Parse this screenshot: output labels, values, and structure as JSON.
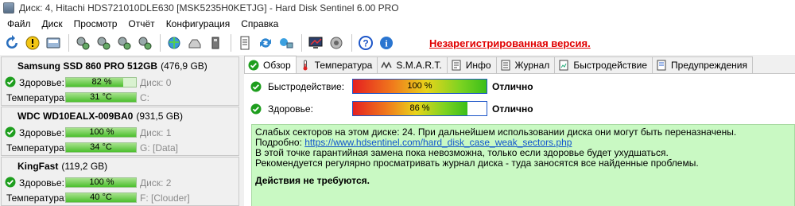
{
  "window": {
    "title": "Диск: 4, Hitachi HDS721010DLE630 [MSK5235H0KETJG]  -  Hard Disk Sentinel 6.00 PRO"
  },
  "menu": [
    "Файл",
    "Диск",
    "Просмотр",
    "Отчёт",
    "Конфигурация",
    "Справка"
  ],
  "toolbar": {
    "buttons": [
      "refresh-icon",
      "alert-icon",
      "disk-check-icon",
      "sep",
      "disk-tools-1-icon",
      "disk-tools-2-icon",
      "disk-tools-3-icon",
      "disk-tools-4-icon",
      "sep",
      "network-icon",
      "drive-icon",
      "usb-drive-icon",
      "sep",
      "report-icon",
      "sync-icon",
      "share-icon",
      "sep",
      "monitor-icon",
      "speaker-icon",
      "sep",
      "help-icon",
      "info-icon"
    ],
    "unregistered": "Незарегистрированная версия."
  },
  "disks": [
    {
      "name": "Samsung SSD 860 PRO 512GB",
      "size": "(476,9 GB)",
      "health_label": "Здоровье:",
      "health": "82 %",
      "health_fraction": 0.82,
      "disk_index": "Диск: 0",
      "temp_label": "Температура:",
      "temp": "31 °C",
      "volume": "C:"
    },
    {
      "name": "WDC WD10EALX-009BA0",
      "size": "(931,5 GB)",
      "health_label": "Здоровье:",
      "health": "100 %",
      "health_fraction": 1.0,
      "disk_index": "Диск: 1",
      "temp_label": "Температура:",
      "temp": "34 °C",
      "volume": "G: [Data]"
    },
    {
      "name": "KingFast",
      "size": "(119,2 GB)",
      "health_label": "Здоровье:",
      "health": "100 %",
      "health_fraction": 1.0,
      "disk_index": "Диск: 2",
      "temp_label": "Температура:",
      "temp": "40 °C",
      "volume": "F: [Clouder]"
    }
  ],
  "tabs": [
    {
      "label": "Обзор",
      "icon": "check-icon",
      "active": true
    },
    {
      "label": "Температура",
      "icon": "thermometer-icon",
      "active": false
    },
    {
      "label": "S.M.A.R.T.",
      "icon": "smart-icon",
      "active": false
    },
    {
      "label": "Инфо",
      "icon": "info-icon",
      "active": false
    },
    {
      "label": "Журнал",
      "icon": "log-icon",
      "active": false
    },
    {
      "label": "Быстродействие",
      "icon": "performance-icon",
      "active": false
    },
    {
      "label": "Предупреждения",
      "icon": "warnings-icon",
      "active": false
    }
  ],
  "overview": {
    "performance": {
      "label": "Быстродействие:",
      "value": "100 %",
      "fraction": 1.0,
      "rating": "Отлично"
    },
    "health": {
      "label": "Здоровье:",
      "value": "86 %",
      "fraction": 0.86,
      "rating": "Отлично"
    },
    "info": {
      "line1": "Слабых секторов на этом диске: 24. При дальнейшем использовании диска они могут быть переназначены.",
      "line2_prefix": "Подробно: ",
      "line2_link": "https://www.hdsentinel.com/hard_disk_case_weak_sectors.php",
      "line3": "В этой точке гарантийная замена пока невозможна, только если здоровье будет ухудшаться.",
      "line4": "Рекомендуется регулярно просматривать журнал диска - туда заносятся все найденные проблемы.",
      "line5": "Действия не требуются."
    }
  },
  "colors": {
    "ok_green": "#1e9e1e",
    "unregistered_red": "#e00000",
    "info_bg": "#c9f9c3",
    "bar_border": "#1d56c8"
  }
}
